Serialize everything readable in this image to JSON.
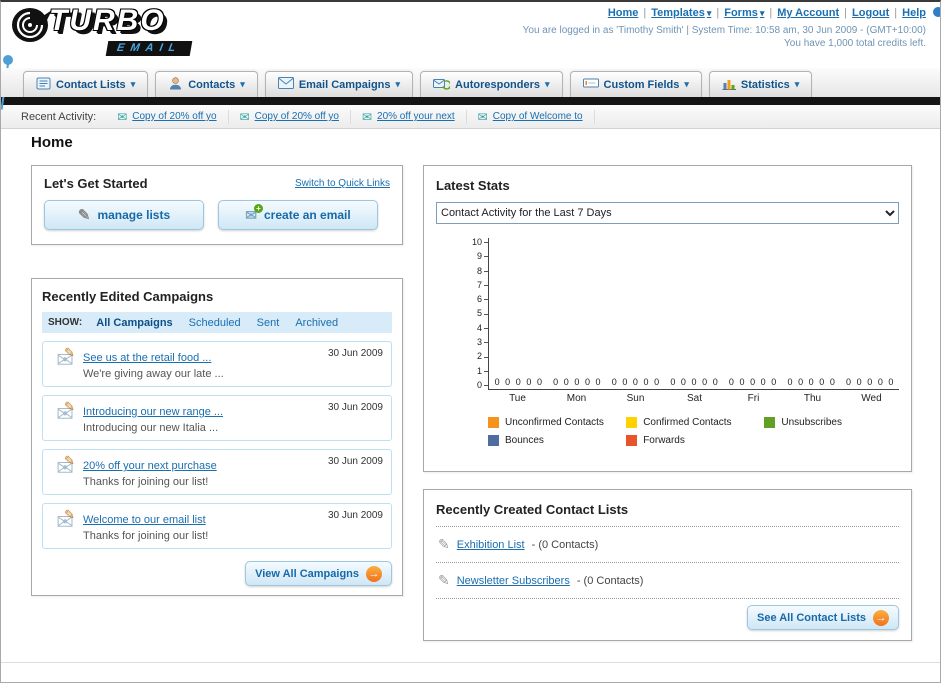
{
  "colors": {
    "accent_orange": "#f28a20",
    "link_blue": "#1a6fb0",
    "black_bar": "#141414"
  },
  "header": {
    "logo_primary": "TURBO",
    "logo_secondary": "EMAIL",
    "nav": [
      {
        "label": "Home"
      },
      {
        "label": "Templates"
      },
      {
        "label": "Forms"
      },
      {
        "label": "My Account"
      },
      {
        "label": "Logout"
      },
      {
        "label": "Help"
      }
    ],
    "session_line": "You are logged in as 'Timothy Smith' | System Time: 10:58 am, 30 Jun 2009 - (GMT+10:00)",
    "credits_line": "You have 1,000 total credits left."
  },
  "tabs": [
    {
      "label": "Contact Lists"
    },
    {
      "label": "Contacts"
    },
    {
      "label": "Email Campaigns"
    },
    {
      "label": "Autoresponders"
    },
    {
      "label": "Custom Fields"
    },
    {
      "label": "Statistics"
    }
  ],
  "recent_activity": {
    "label": "Recent Activity:",
    "items": [
      {
        "label": "Copy of 20% off yo"
      },
      {
        "label": "Copy of 20% off yo"
      },
      {
        "label": "20% off your next"
      },
      {
        "label": "Copy of Welcome to"
      }
    ]
  },
  "page_title": "Home",
  "get_started": {
    "title": "Let's Get Started",
    "switch_link": "Switch to Quick Links",
    "buttons": [
      {
        "label": "manage lists"
      },
      {
        "label": "create an email"
      }
    ]
  },
  "campaigns": {
    "title": "Recently Edited Campaigns",
    "show_label": "SHOW:",
    "filters": [
      {
        "label": "All Campaigns",
        "selected": true
      },
      {
        "label": "Scheduled",
        "selected": false
      },
      {
        "label": "Sent",
        "selected": false
      },
      {
        "label": "Archived",
        "selected": false
      }
    ],
    "items": [
      {
        "title": "See us at the retail food ...",
        "subtitle": "We're giving away our late ...",
        "date": "30 Jun 2009"
      },
      {
        "title": "Introducing our new range ...",
        "subtitle": "Introducing our new Italia ...",
        "date": "30 Jun 2009"
      },
      {
        "title": "20% off your next purchase",
        "subtitle": "Thanks for joining our list!",
        "date": "30 Jun 2009"
      },
      {
        "title": "Welcome to our email list",
        "subtitle": "Thanks for joining our list!",
        "date": "30 Jun 2009"
      }
    ],
    "view_all_label": "View All Campaigns"
  },
  "stats": {
    "title": "Latest Stats",
    "dropdown_value": "Contact Activity for the Last 7 Days",
    "chart_data": {
      "type": "bar",
      "title": "Contact Activity for the Last 7 Days",
      "categories": [
        "Tue",
        "Mon",
        "Sun",
        "Sat",
        "Fri",
        "Thu",
        "Wed"
      ],
      "series": [
        {
          "name": "Unconfirmed Contacts",
          "color": "#f6921e",
          "values": [
            0,
            0,
            0,
            0,
            0,
            0,
            0
          ]
        },
        {
          "name": "Confirmed Contacts",
          "color": "#ffd200",
          "values": [
            0,
            0,
            0,
            0,
            0,
            0,
            0
          ]
        },
        {
          "name": "Unsubscribes",
          "color": "#61a024",
          "values": [
            0,
            0,
            0,
            0,
            0,
            0,
            0
          ]
        },
        {
          "name": "Bounces",
          "color": "#4f6d9f",
          "values": [
            0,
            0,
            0,
            0,
            0,
            0,
            0
          ]
        },
        {
          "name": "Forwards",
          "color": "#e8542a",
          "values": [
            0,
            0,
            0,
            0,
            0,
            0,
            0
          ]
        }
      ],
      "ylim": [
        0,
        10
      ],
      "yticks": [
        0,
        1,
        2,
        3,
        4,
        5,
        6,
        7,
        8,
        9,
        10
      ],
      "xlabel": "",
      "ylabel": "",
      "grid": false,
      "legend_position": "bottom",
      "data_labels_shown": true
    }
  },
  "contact_lists": {
    "title": "Recently Created Contact Lists",
    "items": [
      {
        "name": "Exhibition List",
        "suffix": "- (0 Contacts)"
      },
      {
        "name": "Newsletter Subscribers",
        "suffix": "- (0 Contacts)"
      }
    ],
    "see_all_label": "See All Contact Lists"
  }
}
